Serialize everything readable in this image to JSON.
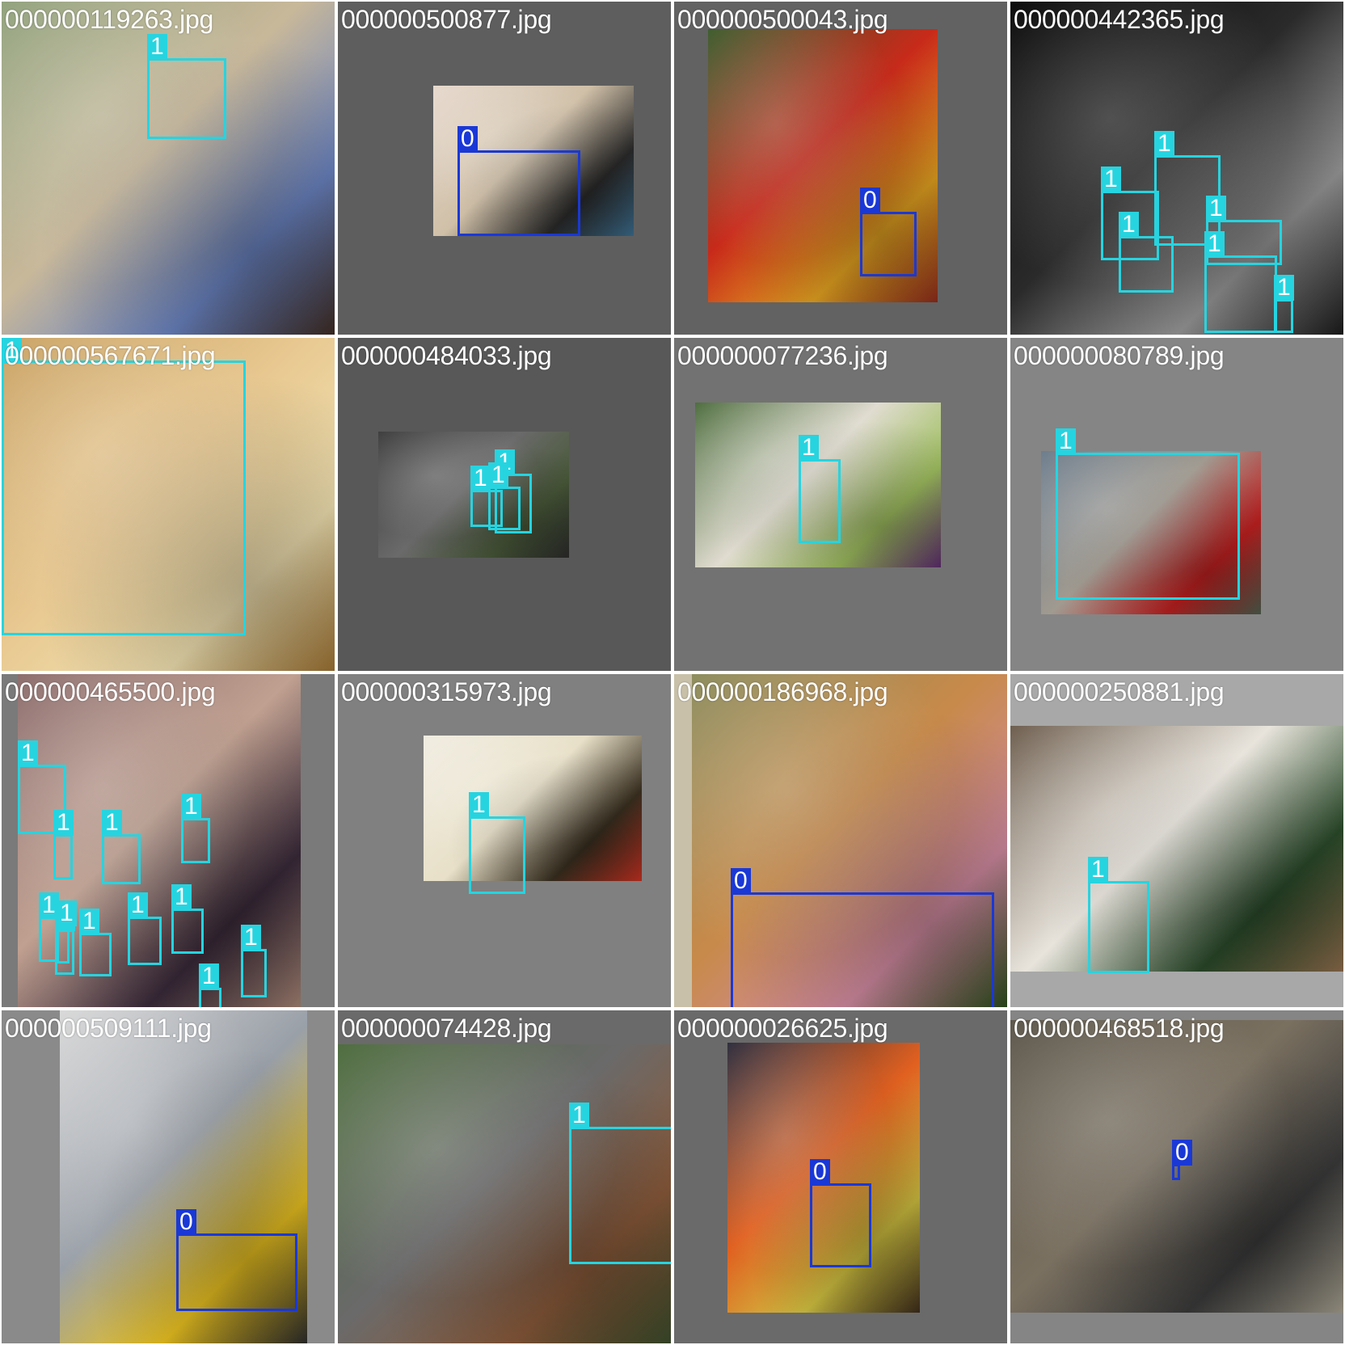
{
  "mosaic": {
    "label_colors": {
      "0": "#1a38d6",
      "1": "#26d4e0"
    },
    "tiles": [
      {
        "filename": "000000119263.jpg",
        "bg": "#727272",
        "photo": {
          "colors": [
            "#8fa07a",
            "#c8b89a",
            "#6a83c0",
            "#3c2a22"
          ]
        },
        "boxes": [
          {
            "cls": "1"
          }
        ]
      },
      {
        "filename": "000000500877.jpg",
        "bg": "#5e5e5e",
        "photo": {
          "colors": [
            "#e6d8cc",
            "#d0c0a8",
            "#2a2a2a",
            "#3a6a8a"
          ]
        },
        "boxes": [
          {
            "cls": "0"
          }
        ]
      },
      {
        "filename": "000000500043.jpg",
        "bg": "#626262",
        "photo": {
          "colors": [
            "#3a5a2a",
            "#c82a1a",
            "#e0a020",
            "#8a2a1a"
          ]
        },
        "boxes": [
          {
            "cls": "0"
          }
        ]
      },
      {
        "filename": "000000442365.jpg",
        "bg": "#0a0a0a",
        "photo": {
          "colors": [
            "#050505",
            "#2a2a2a",
            "#9a9a9a",
            "#1a1a1a"
          ]
        },
        "boxes": [
          {
            "cls": "1"
          },
          {
            "cls": "1"
          },
          {
            "cls": "1"
          },
          {
            "cls": "1"
          },
          {
            "cls": "1"
          },
          {
            "cls": "1"
          }
        ]
      },
      {
        "filename": "000000567671.jpg",
        "bg": "#7a6a50",
        "photo": {
          "colors": [
            "#c8a060",
            "#e8c890",
            "#f0e0b0",
            "#9a7030"
          ]
        },
        "boxes": [
          {
            "cls": "1"
          }
        ]
      },
      {
        "filename": "000000484033.jpg",
        "bg": "#585858",
        "photo": {
          "colors": [
            "#3a3a3a",
            "#6a6a6a",
            "#4a5a3a",
            "#2a2a2a"
          ]
        },
        "boxes": [
          {
            "cls": "1"
          },
          {
            "cls": "1"
          },
          {
            "cls": "1"
          }
        ]
      },
      {
        "filename": "000000077236.jpg",
        "bg": "#727272",
        "photo": {
          "colors": [
            "#4a6a3a",
            "#e0dcd0",
            "#a0c060",
            "#5a2a6a"
          ]
        },
        "boxes": [
          {
            "cls": "1"
          }
        ]
      },
      {
        "filename": "000000080789.jpg",
        "bg": "#858585",
        "photo": {
          "colors": [
            "#6a7a8a",
            "#a09a90",
            "#c02020",
            "#4a5a4a"
          ]
        },
        "boxes": [
          {
            "cls": "1"
          }
        ]
      },
      {
        "filename": "000000465500.jpg",
        "bg": "#7a7a7a",
        "photo": {
          "colors": [
            "#8a6a6a",
            "#c0a090",
            "#3a2a3a",
            "#a08070"
          ]
        },
        "boxes": [
          {
            "cls": "1"
          },
          {
            "cls": "1"
          },
          {
            "cls": "1"
          },
          {
            "cls": "1"
          },
          {
            "cls": "1"
          },
          {
            "cls": "1"
          },
          {
            "cls": "1"
          },
          {
            "cls": "1"
          },
          {
            "cls": "1"
          },
          {
            "cls": "1"
          },
          {
            "cls": "1"
          },
          {
            "cls": "1"
          }
        ]
      },
      {
        "filename": "000000315973.jpg",
        "bg": "#808080",
        "photo": {
          "colors": [
            "#f0ece0",
            "#e8e0c8",
            "#3a3020",
            "#c03020"
          ]
        },
        "boxes": [
          {
            "cls": "1"
          }
        ]
      },
      {
        "filename": "000000186968.jpg",
        "bg": "#c8c0a8",
        "photo": {
          "colors": [
            "#8a8a5a",
            "#c88a4a",
            "#d08aa0",
            "#2a4a1a"
          ]
        },
        "boxes": [
          {
            "cls": "0"
          }
        ]
      },
      {
        "filename": "000000250881.jpg",
        "bg": "#a8a8a8",
        "photo": {
          "colors": [
            "#6a5a4a",
            "#e8e4dc",
            "#2a4a2a",
            "#8a6a4a"
          ]
        },
        "boxes": [
          {
            "cls": "1"
          }
        ]
      },
      {
        "filename": "000000509111.jpg",
        "bg": "#8a8a8a",
        "photo": {
          "colors": [
            "#d8d8d8",
            "#9aa0a8",
            "#e8c020",
            "#2a2a2a"
          ]
        },
        "boxes": [
          {
            "cls": "0"
          }
        ]
      },
      {
        "filename": "000000074428.jpg",
        "bg": "#6a6a6a",
        "photo": {
          "colors": [
            "#4a6a3a",
            "#6a6a6a",
            "#8a5a3a",
            "#3a4a2a"
          ]
        },
        "boxes": [
          {
            "cls": "1"
          }
        ]
      },
      {
        "filename": "000000026625.jpg",
        "bg": "#6a6a6a",
        "photo": {
          "colors": [
            "#2a2a3a",
            "#e06020",
            "#d0c040",
            "#3a2a1a"
          ]
        },
        "boxes": [
          {
            "cls": "0"
          }
        ]
      },
      {
        "filename": "000000468518.jpg",
        "bg": "#858585",
        "photo": {
          "colors": [
            "#5a5448",
            "#7a7060",
            "#3a3a3a",
            "#a09a8a"
          ]
        },
        "boxes": [
          {
            "cls": "0"
          }
        ]
      }
    ]
  }
}
